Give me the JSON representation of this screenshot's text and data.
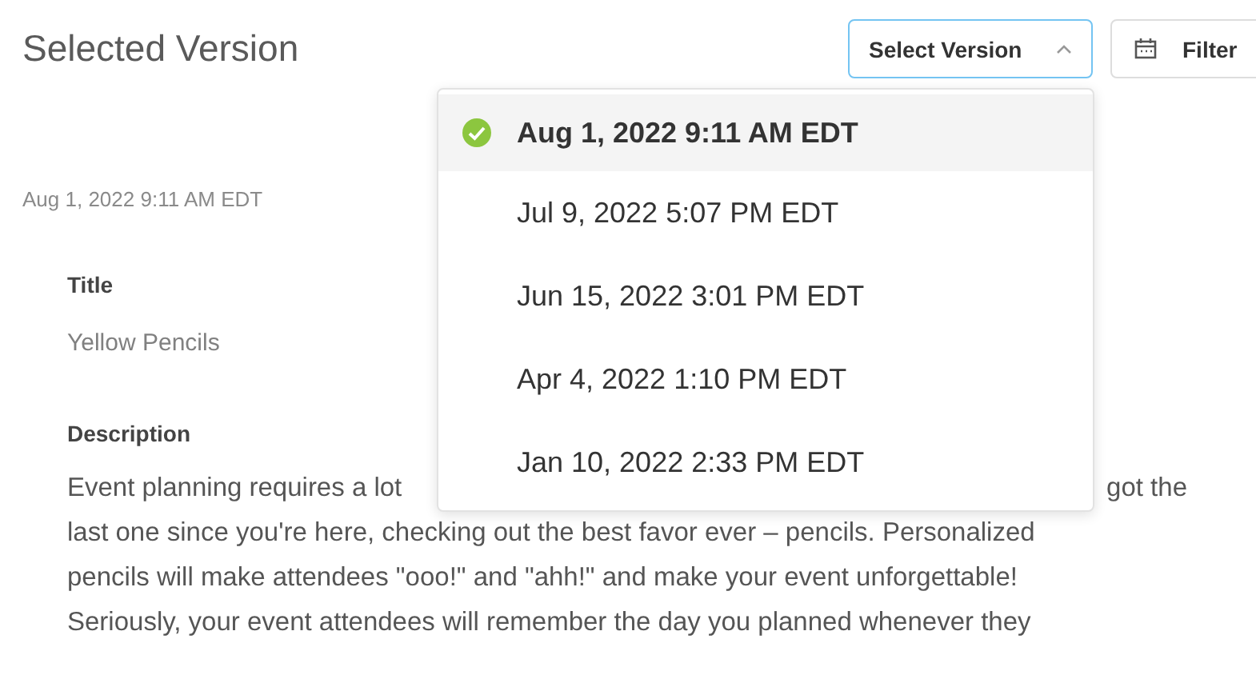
{
  "page_title": "Selected Version",
  "version_select": {
    "label": "Select Version",
    "expanded": true
  },
  "filter_button": {
    "label": "Filter"
  },
  "versions": [
    {
      "label": "Aug 1, 2022 9:11 AM EDT",
      "selected": true
    },
    {
      "label": "Jul 9, 2022 5:07 PM EDT",
      "selected": false
    },
    {
      "label": "Jun 15, 2022 3:01 PM EDT",
      "selected": false
    },
    {
      "label": "Apr 4, 2022 1:10 PM EDT",
      "selected": false
    },
    {
      "label": "Jan 10, 2022 2:33 PM EDT",
      "selected": false
    }
  ],
  "details": {
    "version_date": "Aug 1, 2022 9:11 AM EDT",
    "title_label": "Title",
    "title_value": "Yellow Pencils",
    "description_label": "Description",
    "description_lines": [
      {
        "left": "Event planning requires a lot",
        "right": "got the"
      },
      {
        "left": "last one since you're here, checking out the best favor ever – pencils. Personalized"
      },
      {
        "left": "pencils will make attendees \"ooo!\" and \"ahh!\" and make your event unforgettable!"
      },
      {
        "left": "Seriously, your event attendees will remember the day you planned whenever they"
      }
    ]
  }
}
